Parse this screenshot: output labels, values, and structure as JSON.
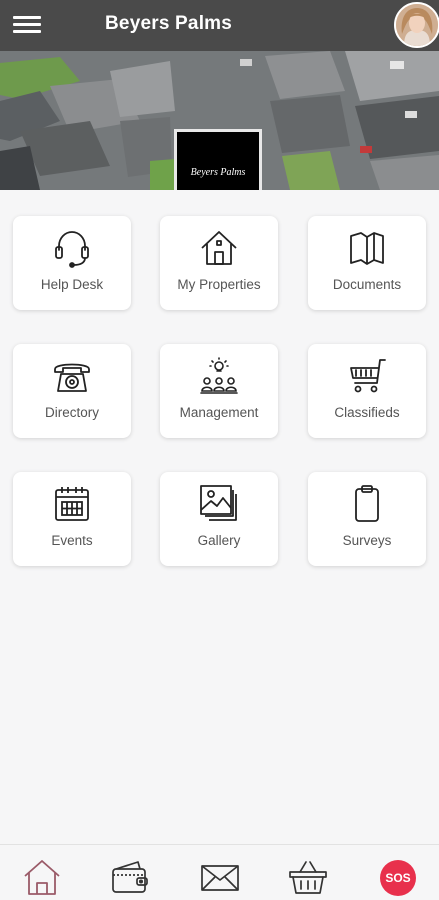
{
  "header": {
    "title": "Beyers Palms",
    "menu_icon": "hamburger-menu-icon",
    "avatar_icon": "user-avatar"
  },
  "banner": {
    "logo_text": "Beyers Palms"
  },
  "tiles": [
    {
      "label": "Help Desk",
      "icon": "headset-icon"
    },
    {
      "label": "My Properties",
      "icon": "house-icon"
    },
    {
      "label": "Documents",
      "icon": "book-icon"
    },
    {
      "label": "Directory",
      "icon": "telephone-icon"
    },
    {
      "label": "Management",
      "icon": "team-lightbulb-icon"
    },
    {
      "label": "Classifieds",
      "icon": "shopping-cart-icon"
    },
    {
      "label": "Events",
      "icon": "calendar-icon"
    },
    {
      "label": "Gallery",
      "icon": "gallery-icon"
    },
    {
      "label": "Surveys",
      "icon": "clipboard-icon"
    }
  ],
  "bottom_nav": {
    "items": [
      "home-icon",
      "wallet-icon",
      "mail-icon",
      "basket-icon"
    ],
    "sos_label": "SOS"
  },
  "colors": {
    "topbar": "#4a4a4a",
    "accent_home": "#9a5a68",
    "sos": "#e8304c",
    "icon_stroke": "#222222",
    "label_text": "#555555"
  }
}
